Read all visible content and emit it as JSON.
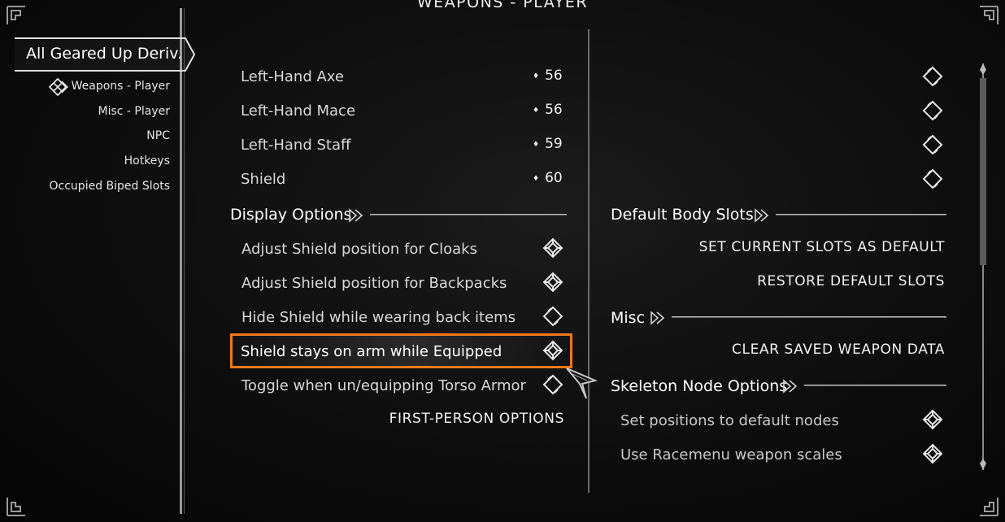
{
  "page_title": "WEAPONS - PLAYER",
  "sidebar": {
    "mod_name": "All Geared Up Deriv.",
    "pages": [
      {
        "label": "Weapons - Player",
        "selected": true
      },
      {
        "label": "Misc - Player"
      },
      {
        "label": "NPC"
      },
      {
        "label": "Hotkeys"
      },
      {
        "label": "Occupied Biped Slots"
      }
    ]
  },
  "left_column": {
    "sliders": [
      {
        "label": "Left-Hand Axe",
        "value": "56"
      },
      {
        "label": "Left-Hand Mace",
        "value": "56"
      },
      {
        "label": "Left-Hand Staff",
        "value": "59"
      },
      {
        "label": "Shield",
        "value": "60"
      }
    ],
    "display_options": {
      "header": "Display Options",
      "toggles": [
        {
          "label": "Adjust Shield position for Cloaks",
          "checked": true
        },
        {
          "label": "Adjust Shield position for Backpacks",
          "checked": true
        },
        {
          "label": "Hide Shield while wearing back items",
          "checked": false
        },
        {
          "label": "Shield stays on arm while Equipped",
          "checked": true,
          "highlighted": true
        },
        {
          "label": "Toggle when un/equipping Torso Armor",
          "checked": false
        }
      ],
      "first_person_button": "FIRST-PERSON OPTIONS"
    }
  },
  "right_column": {
    "top_toggles": [
      {
        "checked": false
      },
      {
        "checked": false
      },
      {
        "checked": false
      },
      {
        "checked": false
      }
    ],
    "default_body_slots": {
      "header": "Default Body Slots",
      "set_button": "SET CURRENT SLOTS AS DEFAULT",
      "restore_button": "RESTORE DEFAULT SLOTS"
    },
    "misc": {
      "header": "Misc",
      "clear_button": "CLEAR SAVED WEAPON DATA"
    },
    "skeleton": {
      "header": "Skeleton Node Options",
      "toggles": [
        {
          "label": "Set positions to default nodes",
          "checked": true
        },
        {
          "label": "Use Racemenu weapon scales",
          "checked": true
        }
      ]
    }
  },
  "colors": {
    "highlight_border": "#f07a18",
    "text": "#e8e8e8",
    "background": "#0d0d0d"
  }
}
